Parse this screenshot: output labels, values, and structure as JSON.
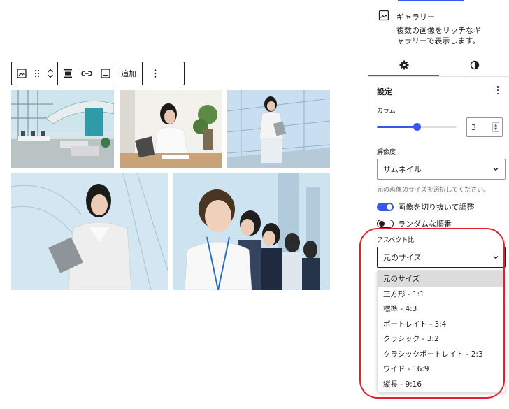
{
  "toolbar": {
    "add_label": "追加"
  },
  "block": {
    "title": "ギャラリー",
    "description": "複数の画像をリッチなギャラリーで表示します。"
  },
  "settings": {
    "title": "設定",
    "columns_label": "カラム",
    "columns_value": "3",
    "columns_fraction": 0.5,
    "resolution_label": "解像度",
    "resolution_value": "サムネイル",
    "resolution_help": "元の画像のサイズを選択してください。",
    "crop_label": "画像を切り抜いて調整",
    "crop_on": true,
    "random_label": "ランダムな順番",
    "random_on": false,
    "aspect_label": "アスペクト比",
    "aspect_value": "元のサイズ",
    "aspect_options": [
      "元のサイズ",
      "正方形 - 1:1",
      "標準 - 4:3",
      "ポートレイト - 3:4",
      "クラシック - 3:2",
      "クラシックポートレイト - 2:3",
      "ワイド - 16:9",
      "縦長 - 9:16"
    ]
  },
  "colors": {
    "accent": "#3858e9",
    "annotation": "#e0202a"
  }
}
